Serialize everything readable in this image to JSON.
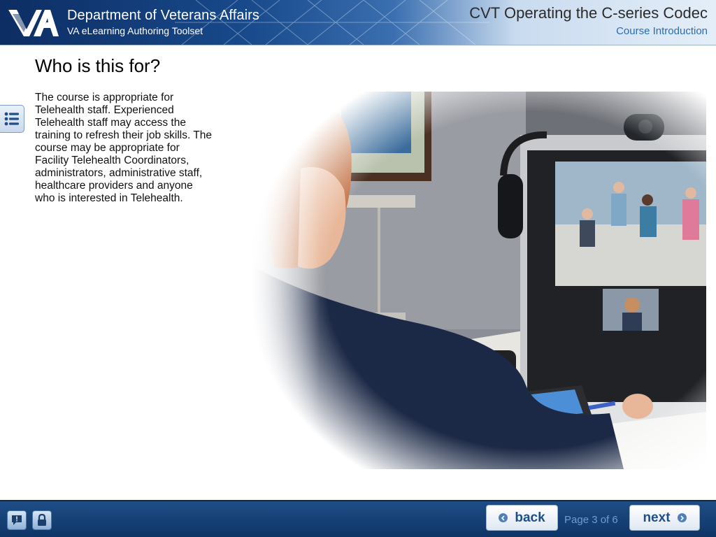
{
  "header": {
    "org_title": "Department of Veterans Affairs",
    "org_subtitle": "VA eLearning Authoring Toolset",
    "course_title": "CVT Operating the C-series Codec",
    "section": "Course Introduction"
  },
  "content": {
    "heading": "Who is this for?",
    "body": "The course is appropriate for Telehealth staff. Experienced Telehealth staff may access the training to refresh their job skills. The course may be appropriate for Facility Telehealth Coordinators, administrators, administrative staff, healthcare providers and anyone who is interested in Telehealth."
  },
  "icons": {
    "menu": "list-icon",
    "help": "help-icon",
    "lock": "lock-icon",
    "back": "chevron-left-icon",
    "next": "chevron-right-icon",
    "logo": "va-logo"
  },
  "footer": {
    "back_label": "back",
    "next_label": "next",
    "page_indicator": "Page 3 of 6"
  },
  "colors": {
    "header_dark": "#0d2d63",
    "footer": "#1e4d86",
    "accent_text": "#2a6db3",
    "button_text": "#1f4f86"
  }
}
